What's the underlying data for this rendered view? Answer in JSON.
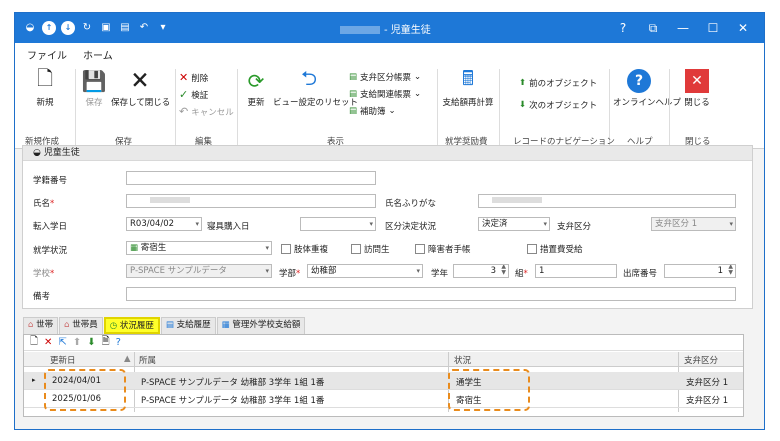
{
  "window": {
    "title": "- 児童生徒",
    "controls": [
      "?",
      "⧉",
      "—",
      "☐",
      "✕"
    ]
  },
  "menu_tabs": [
    {
      "label": "ファイル",
      "active": false
    },
    {
      "label": "ホーム",
      "active": true
    }
  ],
  "ribbon": {
    "new": "新規",
    "save": "保存",
    "save_close": "保存して閉じる",
    "delete": "削除",
    "verify": "検証",
    "cancel": "キャンセル",
    "refresh": "更新",
    "reset_view": "ビュー設定のリセット",
    "sub_ledger": "支弁区分帳票",
    "related_ledger": "支給関連帳票",
    "aux_ledger": "補助簿",
    "recalc": "支給額再計算",
    "prev_obj": "前のオブジェクト",
    "next_obj": "次のオブジェクト",
    "online_help": "オンラインヘルプ",
    "close": "閉じる",
    "groups": [
      "新規作成",
      "保存",
      "編集",
      "表示",
      "就学奨励費",
      "レコードのナビゲーション",
      "ヘルプ",
      "閉じる"
    ]
  },
  "form": {
    "header": "児童生徒",
    "labels": {
      "student_no": "学籍番号",
      "name": "氏名",
      "name_kana": "氏名ふりがな",
      "transfer_date": "転入学日",
      "bedding_date": "寝具購入日",
      "decision_status": "区分決定状況",
      "support_cat": "支弁区分",
      "enroll_status": "就学状況",
      "school": "学校",
      "dept": "学部",
      "grade": "学年",
      "class": "組",
      "seat_no": "出席番号",
      "remarks": "備考"
    },
    "values": {
      "transfer_date": "R03/04/02",
      "decision_status": "決定済",
      "support_cat": "支弁区分 1",
      "enroll_status": "寄宿生",
      "school": "P-SPACE サンプルデータ",
      "dept": "幼稚部",
      "grade": "3",
      "class": "1",
      "seat_no": "1"
    },
    "checkboxes": [
      "肢体重複",
      "訪問生",
      "障害者手帳",
      "措置費受給"
    ]
  },
  "subtabs": [
    "世帯",
    "世帯員",
    "状況履歴",
    "支給履歴",
    "管理外学校支給額"
  ],
  "grid": {
    "columns": [
      "更新日",
      "所属",
      "状況",
      "支弁区分"
    ],
    "rows": [
      [
        "2024/04/01",
        "P-SPACE サンプルデータ 幼稚部 3学年 1組 1番",
        "通学生",
        "支弁区分 1"
      ],
      [
        "2025/01/06",
        "P-SPACE サンプルデータ 幼稚部 3学年 1組 1番",
        "寄宿生",
        "支弁区分 1"
      ]
    ]
  },
  "colors": {
    "titlebar": "#1e78d7",
    "highlight_tab": "#ffff2a",
    "dashed_highlight": "#e98b1c"
  }
}
